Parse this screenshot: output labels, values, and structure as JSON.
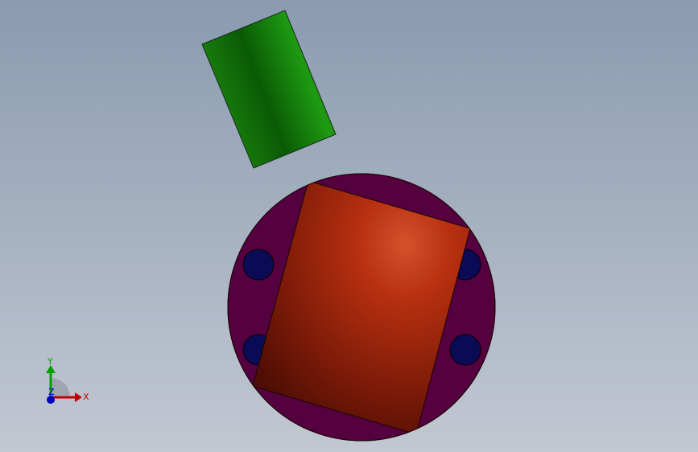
{
  "viewport": {
    "background_top": "#8a9bb0",
    "background_bottom": "#c2c8d2"
  },
  "parts": {
    "cylinder": {
      "color": "#1a8a0a"
    },
    "ball": {
      "color": "#b83010"
    },
    "disk": {
      "color": "#55003f"
    },
    "holes": {
      "color": "#0b0b55",
      "count": 4
    }
  },
  "triad": {
    "x_label": "X",
    "y_label": "Y",
    "z_label": "Z",
    "x_color": "#c00000",
    "y_color": "#00a000",
    "z_color": "#0000c0"
  }
}
